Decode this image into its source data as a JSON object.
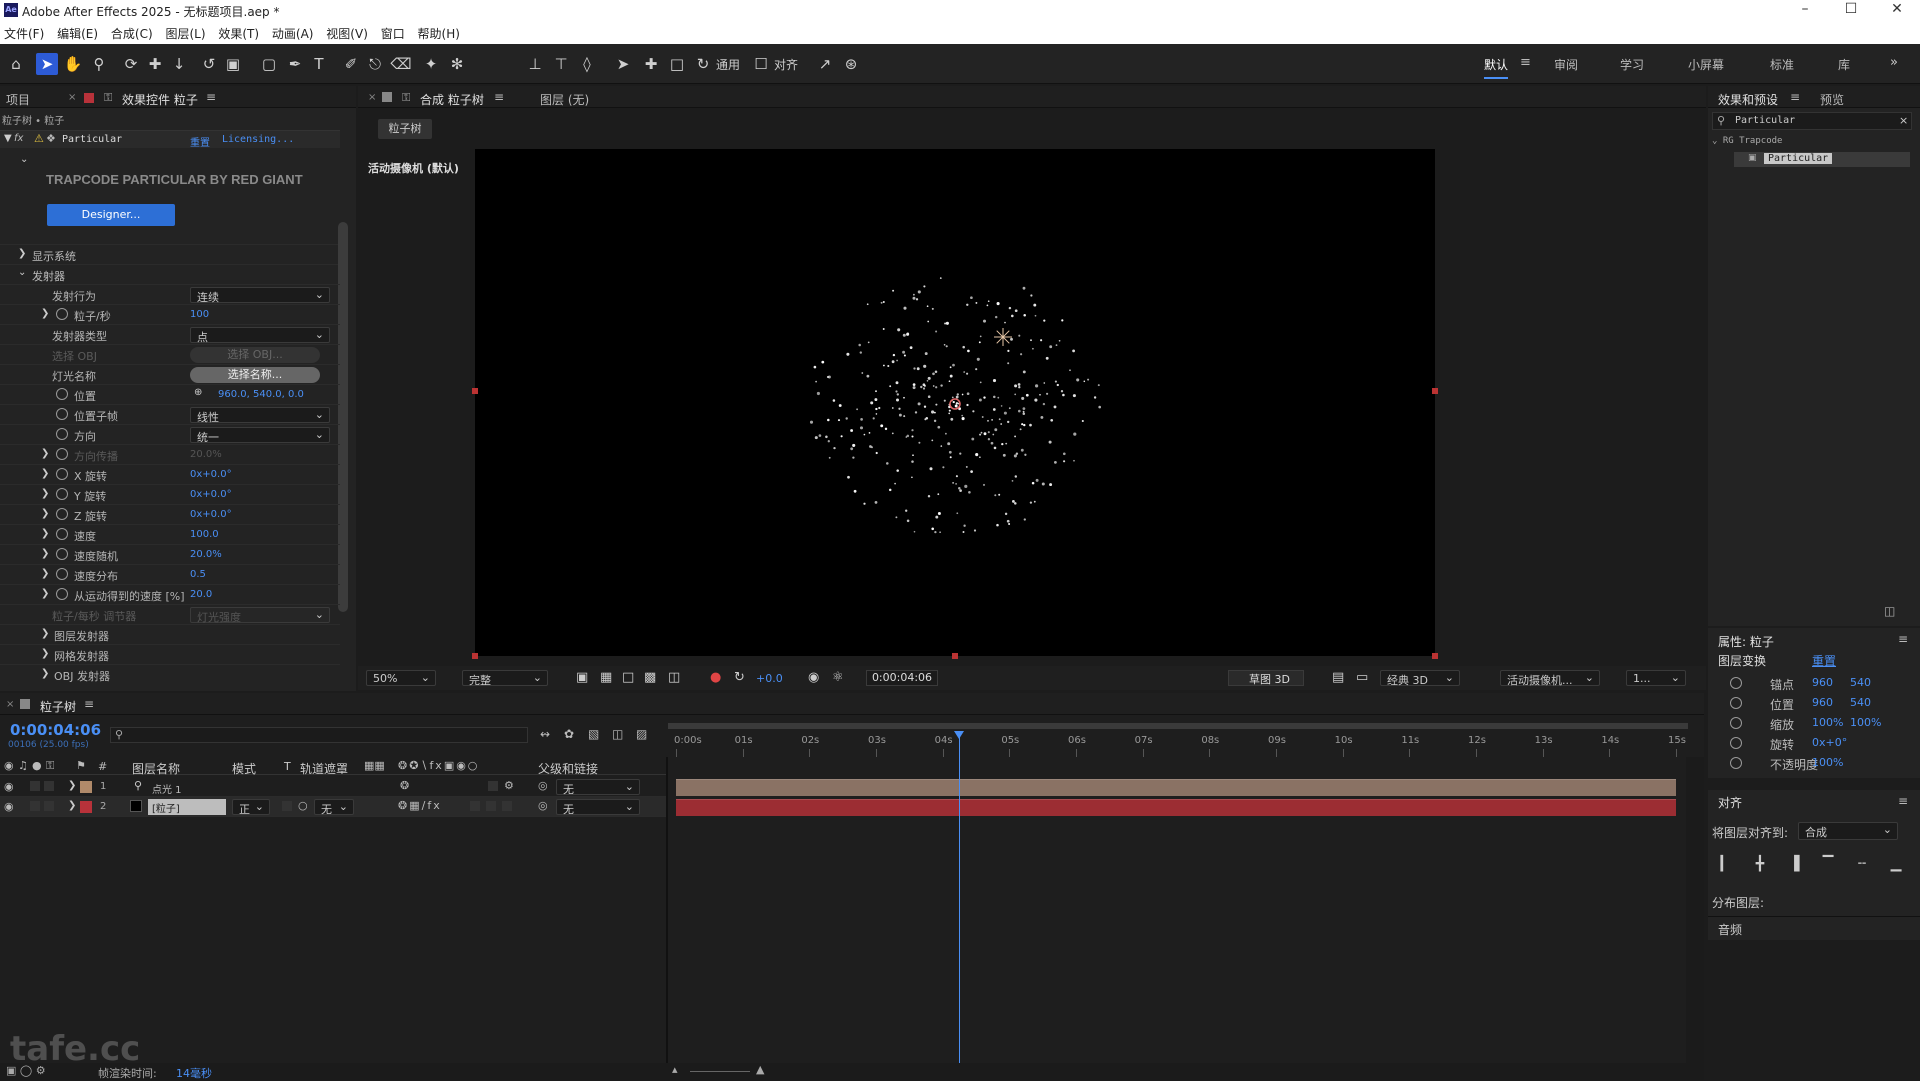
{
  "window": {
    "title": "Adobe After Effects 2025 - 无标题项目.aep *",
    "app_icon": "Ae"
  },
  "menu": [
    "文件(F)",
    "编辑(E)",
    "合成(C)",
    "图层(L)",
    "效果(T)",
    "动画(A)",
    "视图(V)",
    "窗口",
    "帮助(H)"
  ],
  "toolbar": {
    "general_label": "通用",
    "align_label": "对齐",
    "workspaces": [
      "默认",
      "审阅",
      "学习",
      "小屏幕",
      "标准",
      "库"
    ]
  },
  "left_panel": {
    "tab_project": "项目",
    "tab_effects": "效果控件 粒子",
    "breadcrumb": "粒子树 • 粒子",
    "effect_name": "Particular",
    "reset": "重置",
    "licensing": "Licensing...",
    "banner": "TRAPCODE PARTICULAR BY RED GIANT",
    "designer": "Designer...",
    "show_system": "显示系统",
    "emitter": "发射器",
    "props": [
      {
        "label": "发射行为",
        "type": "dropdown",
        "value": "连续"
      },
      {
        "label": "粒子/秒",
        "type": "value",
        "value": "100"
      },
      {
        "label": "发射器类型",
        "type": "dropdown",
        "value": "点"
      },
      {
        "label": "选择 OBJ",
        "type": "pill",
        "value": "选择 OBJ..."
      },
      {
        "label": "灯光名称",
        "type": "pill",
        "value": "选择名称..."
      },
      {
        "label": "位置",
        "type": "value",
        "value": "960.0, 540.0, 0.0"
      },
      {
        "label": "位置子帧",
        "type": "dropdown",
        "value": "线性"
      },
      {
        "label": "方向",
        "type": "dropdown",
        "value": "统一"
      },
      {
        "label": "方向传播",
        "type": "value",
        "value": "20.0%"
      },
      {
        "label": "X 旋转",
        "type": "value",
        "value": "0x+0.0°"
      },
      {
        "label": "Y 旋转",
        "type": "value",
        "value": "0x+0.0°"
      },
      {
        "label": "Z 旋转",
        "type": "value",
        "value": "0x+0.0°"
      },
      {
        "label": "速度",
        "type": "value",
        "value": "100.0"
      },
      {
        "label": "速度随机",
        "type": "value",
        "value": "20.0%"
      },
      {
        "label": "速度分布",
        "type": "value",
        "value": "0.5"
      },
      {
        "label": "从运动得到的速度 [%]",
        "type": "value",
        "value": "20.0"
      },
      {
        "label": "粒子/每秒 调节器",
        "type": "dropdown",
        "value": "灯光强度"
      },
      {
        "label": "图层发射器",
        "type": "group",
        "value": ""
      },
      {
        "label": "网格发射器",
        "type": "group",
        "value": ""
      },
      {
        "label": "OBJ 发射器",
        "type": "group",
        "value": ""
      }
    ]
  },
  "viewer": {
    "tab": "合成 粒子树",
    "layer_tab": "图层 (无)",
    "comp_chip": "粒子树",
    "camera_label": "活动摄像机 (默认)",
    "zoom": "50%",
    "quality": "完整",
    "exposure": "+0.0",
    "timecode": "0:00:04:06",
    "draft3d": "草图 3D",
    "renderer": "经典 3D",
    "camera": "活动摄像机...",
    "views": "1..."
  },
  "right_panel": {
    "tab_effects": "效果和预设",
    "tab_preview": "预览",
    "search": "Particular",
    "category": "RG Trapcode",
    "item": "Particular",
    "props_title": "属性: 粒子",
    "layer_transform": "图层变换",
    "reset": "重置",
    "transform": [
      {
        "label": "锚点",
        "v1": "960",
        "v2": "540"
      },
      {
        "label": "位置",
        "v1": "960",
        "v2": "540"
      },
      {
        "label": "缩放",
        "v1": "100%",
        "v2": "100%"
      },
      {
        "label": "旋转",
        "v1": "0x+0°",
        "v2": ""
      },
      {
        "label": "不透明度",
        "v1": "100%",
        "v2": ""
      }
    ],
    "align_title": "对齐",
    "align_to_label": "将图层对齐到:",
    "align_to": "合成",
    "distribute": "分布图层:",
    "audio": "音频"
  },
  "timeline": {
    "tab": "粒子树",
    "timecode": "0:00:04:06",
    "frames": "00106 (25.00 fps)",
    "col_name": "图层名称",
    "col_mode": "模式",
    "col_t": "T",
    "col_trkmat": "轨道遮罩",
    "col_parent": "父级和链接",
    "ruler": [
      "0:00s",
      "01s",
      "02s",
      "03s",
      "04s",
      "05s",
      "06s",
      "07s",
      "08s",
      "09s",
      "10s",
      "11s",
      "12s",
      "13s",
      "14s",
      "15s"
    ],
    "playhead_seconds": 4.24,
    "duration_seconds": 15,
    "layers": [
      {
        "num": "1",
        "name": "点光 1",
        "mode": "",
        "trk": "",
        "parent": "无",
        "color": "#b08a6a"
      },
      {
        "num": "2",
        "name": "[粒子]",
        "mode": "正",
        "trk": "无",
        "parent": "无",
        "color": "#b8323a"
      }
    ],
    "render_label": "帧渲染时间:",
    "render_time": "14毫秒",
    "watermark": "tafe.cc"
  },
  "colors": {
    "accent": "#4a8ff5",
    "layer1": "#8a7264",
    "layer2": "#9c2d33"
  }
}
